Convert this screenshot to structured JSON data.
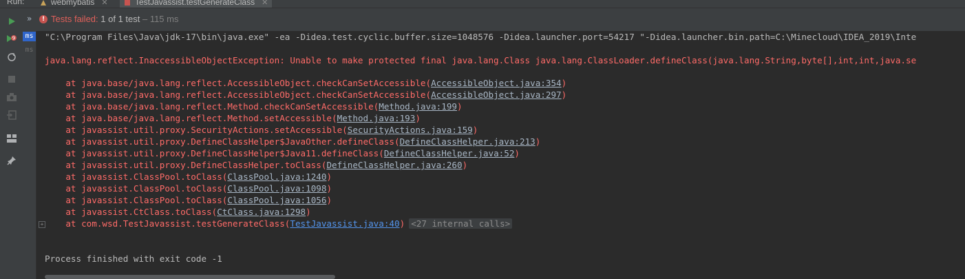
{
  "tabs": {
    "run_label": "Run:",
    "items": [
      {
        "label": "webmybatis",
        "active": false
      },
      {
        "label": "TestJavassist.testGenerateClass",
        "active": true
      }
    ]
  },
  "status": {
    "failed_text": "Tests failed:",
    "counts": " 1 of 1 test",
    "time": " – 115 ms"
  },
  "tree": {
    "items": [
      {
        "label": "ms",
        "selected": true
      },
      {
        "label": "ms",
        "selected": false
      }
    ]
  },
  "console": {
    "command": "\"C:\\Program Files\\Java\\jdk-17\\bin\\java.exe\" -ea -Didea.test.cyclic.buffer.size=1048576 -Didea.launcher.port=54217 \"-Didea.launcher.bin.path=C:\\Minecloud\\IDEA_2019\\Inte",
    "exception": "java.lang.reflect.InaccessibleObjectException: Unable to make protected final java.lang.Class java.lang.ClassLoader.defineClass(java.lang.String,byte[],int,int,java.se",
    "stack": [
      {
        "prefix": "    at java.base/java.lang.reflect.AccessibleObject.checkCanSetAccessible(",
        "link": "AccessibleObject.java:354",
        "suffix": ")"
      },
      {
        "prefix": "    at java.base/java.lang.reflect.AccessibleObject.checkCanSetAccessible(",
        "link": "AccessibleObject.java:297",
        "suffix": ")"
      },
      {
        "prefix": "    at java.base/java.lang.reflect.Method.checkCanSetAccessible(",
        "link": "Method.java:199",
        "suffix": ")"
      },
      {
        "prefix": "    at java.base/java.lang.reflect.Method.setAccessible(",
        "link": "Method.java:193",
        "suffix": ")"
      },
      {
        "prefix": "    at javassist.util.proxy.SecurityActions.setAccessible(",
        "link": "SecurityActions.java:159",
        "suffix": ")"
      },
      {
        "prefix": "    at javassist.util.proxy.DefineClassHelper$JavaOther.defineClass(",
        "link": "DefineClassHelper.java:213",
        "suffix": ")"
      },
      {
        "prefix": "    at javassist.util.proxy.DefineClassHelper$Java11.defineClass(",
        "link": "DefineClassHelper.java:52",
        "suffix": ")"
      },
      {
        "prefix": "    at javassist.util.proxy.DefineClassHelper.toClass(",
        "link": "DefineClassHelper.java:260",
        "suffix": ")"
      },
      {
        "prefix": "    at javassist.ClassPool.toClass(",
        "link": "ClassPool.java:1240",
        "suffix": ")"
      },
      {
        "prefix": "    at javassist.ClassPool.toClass(",
        "link": "ClassPool.java:1098",
        "suffix": ")"
      },
      {
        "prefix": "    at javassist.ClassPool.toClass(",
        "link": "ClassPool.java:1056",
        "suffix": ")"
      },
      {
        "prefix": "    at javassist.CtClass.toClass(",
        "link": "CtClass.java:1298",
        "suffix": ")"
      }
    ],
    "last_frame": {
      "prefix": "    at com.wsd.TestJavassist.testGenerateClass(",
      "link": "TestJavassist.java:40",
      "suffix": ")",
      "internal": "<27 internal calls>",
      "fold": "+"
    },
    "exit": "Process finished with exit code -1"
  },
  "colors": {
    "background": "#2b2b2b",
    "panel": "#3c3f41",
    "error": "#ff6b68",
    "link_blue": "#5394ec",
    "selection": "#2f65ca",
    "run_green": "#499c54"
  }
}
